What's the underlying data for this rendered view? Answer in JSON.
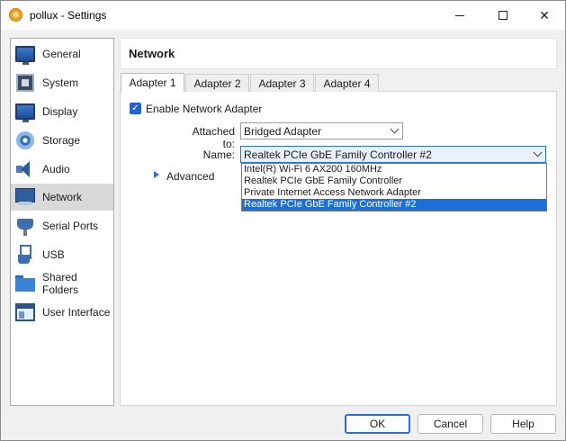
{
  "window": {
    "title": "pollux - Settings",
    "icon": "virtualbox-app-icon",
    "controls": {
      "minimize": "minimize-icon",
      "maximize": "maximize-icon",
      "close": "✕"
    }
  },
  "sidebar": {
    "selected_index": 5,
    "items": [
      {
        "label": "General",
        "icon": "general-monitor-icon"
      },
      {
        "label": "System",
        "icon": "system-chip-icon"
      },
      {
        "label": "Display",
        "icon": "display-monitor-icon"
      },
      {
        "label": "Storage",
        "icon": "storage-disc-icon"
      },
      {
        "label": "Audio",
        "icon": "audio-speaker-icon"
      },
      {
        "label": "Network",
        "icon": "network-adapter-icon"
      },
      {
        "label": "Serial Ports",
        "icon": "serial-port-icon"
      },
      {
        "label": "USB",
        "icon": "usb-icon"
      },
      {
        "label": "Shared Folders",
        "icon": "shared-folder-icon"
      },
      {
        "label": "User Interface",
        "icon": "user-interface-window-icon"
      }
    ]
  },
  "main": {
    "title": "Network",
    "tabs": [
      {
        "label": "Adapter 1",
        "active": true
      },
      {
        "label": "Adapter 2",
        "active": false
      },
      {
        "label": "Adapter 3",
        "active": false
      },
      {
        "label": "Adapter 4",
        "active": false
      }
    ],
    "enable_adapter": {
      "label": "Enable Network Adapter",
      "checked": true,
      "check_glyph": "✓"
    },
    "attached_to": {
      "label": "Attached to:",
      "value": "Bridged Adapter"
    },
    "name": {
      "label": "Name:",
      "value": "Realtek PCIe GbE Family Controller #2",
      "options": [
        "Intel(R) Wi-Fi 6 AX200 160MHz",
        "Realtek PCIe GbE Family Controller",
        "Private Internet Access Network Adapter",
        "Realtek PCIe GbE Family Controller #2"
      ],
      "highlighted_index": 3
    },
    "advanced": {
      "label": "Advanced"
    }
  },
  "buttons": {
    "ok": "OK",
    "cancel": "Cancel",
    "help": "Help"
  },
  "colors": {
    "accent": "#2a6fd6",
    "selection": "#1c6fd6",
    "sidebar_selected": "#d9d9d9"
  }
}
